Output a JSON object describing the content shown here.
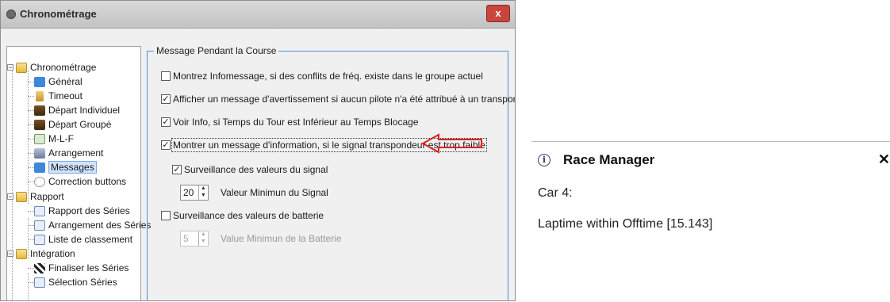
{
  "window": {
    "title": "Chronométrage",
    "close_label": "x"
  },
  "tree": {
    "root1": "Chronométrage",
    "general": "Général",
    "timeout": "Timeout",
    "depart_individuel": "Départ Individuel",
    "depart_groupe": "Départ Groupé",
    "mlf": "M-L-F",
    "arrangement": "Arrangement",
    "messages": "Messages",
    "correction": "Correction buttons",
    "root2": "Rapport",
    "rapport_series": "Rapport des Séries",
    "arrangement_series": "Arrangement des Séries",
    "liste_classement": "Liste de classement",
    "root3": "Intégration",
    "finaliser": "Finaliser les Séries",
    "cut_item": "Sélection Séries"
  },
  "group": {
    "legend": "Message Pendant la Course",
    "opt1": {
      "label": "Montrez Infomessage, si des conflits de fréq. existe dans le groupe actuel",
      "checked": false
    },
    "opt2": {
      "label": "Afficher un message d'avertissement si aucun pilote n'a été attribué à un transpondeur",
      "checked": true
    },
    "opt3": {
      "label": "Voir Info, si Temps du Tour est Inférieur au Temps Blocage",
      "checked": true
    },
    "opt4": {
      "label": "Montrer un message d'information, si le signal transpondeur est trop faible",
      "checked": true
    },
    "signal_check": {
      "label": "Surveillance des valeurs du signal",
      "checked": true
    },
    "signal_value": "20",
    "signal_label": "Valeur Minimun du Signal",
    "battery_check": {
      "label": "Surveillance des valeurs de batterie",
      "checked": false
    },
    "battery_value": "5",
    "battery_label": "Value Minimun de la Batterie"
  },
  "popup": {
    "title": "Race Manager",
    "close": "✕",
    "line1": "Car 4:",
    "line2": "Laptime within Offtime [15.143]"
  },
  "colors": {
    "accent_border": "#4f8fd8",
    "arrow": "#e02020",
    "close_red": "#c9463d"
  },
  "check_mark": "✓"
}
